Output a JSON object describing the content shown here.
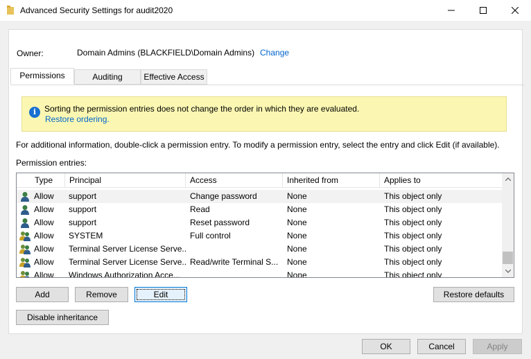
{
  "window": {
    "title": "Advanced Security Settings for audit2020"
  },
  "owner": {
    "label": "Owner:",
    "value": "Domain Admins (BLACKFIELD\\Domain Admins)",
    "change_link": "Change"
  },
  "tabs": [
    {
      "label": "Permissions",
      "active": true
    },
    {
      "label": "Auditing",
      "active": false
    },
    {
      "label": "Effective Access",
      "active": false
    }
  ],
  "info_bar": {
    "message": "Sorting the permission entries does not change the order in which they are evaluated.",
    "link": "Restore ordering."
  },
  "help_text": "For additional information, double-click a permission entry. To modify a permission entry, select the entry and click Edit (if available).",
  "entries_label": "Permission entries:",
  "table": {
    "columns": [
      "Type",
      "Principal",
      "Access",
      "Inherited from",
      "Applies to"
    ],
    "rows": [
      {
        "icon": "user-icon",
        "type": "Allow",
        "principal": "support",
        "access": "Change password",
        "inherited": "None",
        "applies": "This object only"
      },
      {
        "icon": "user-icon",
        "type": "Allow",
        "principal": "support",
        "access": "Read",
        "inherited": "None",
        "applies": "This object only"
      },
      {
        "icon": "user-icon",
        "type": "Allow",
        "principal": "support",
        "access": "Reset password",
        "inherited": "None",
        "applies": "This object only"
      },
      {
        "icon": "group-icon",
        "type": "Allow",
        "principal": "SYSTEM",
        "access": "Full control",
        "inherited": "None",
        "applies": "This object only"
      },
      {
        "icon": "group-icon",
        "type": "Allow",
        "principal": "Terminal Server License Serve...",
        "access": "",
        "inherited": "None",
        "applies": "This object only"
      },
      {
        "icon": "group-icon",
        "type": "Allow",
        "principal": "Terminal Server License Serve...",
        "access": "Read/write Terminal S...",
        "inherited": "None",
        "applies": "This object only"
      },
      {
        "icon": "group-icon",
        "type": "Allow",
        "principal": "Windows Authorization Acce...",
        "access": "",
        "inherited": "None",
        "applies": "This object only"
      }
    ]
  },
  "buttons": {
    "add": "Add",
    "remove": "Remove",
    "edit": "Edit",
    "restore_defaults": "Restore defaults",
    "disable_inheritance": "Disable inheritance",
    "ok": "OK",
    "cancel": "Cancel",
    "apply": "Apply"
  },
  "colors": {
    "link": "#0066cc",
    "info_bg": "#fbf7b2",
    "info_icon": "#1a6fd1",
    "focus_border": "#0078d7"
  }
}
